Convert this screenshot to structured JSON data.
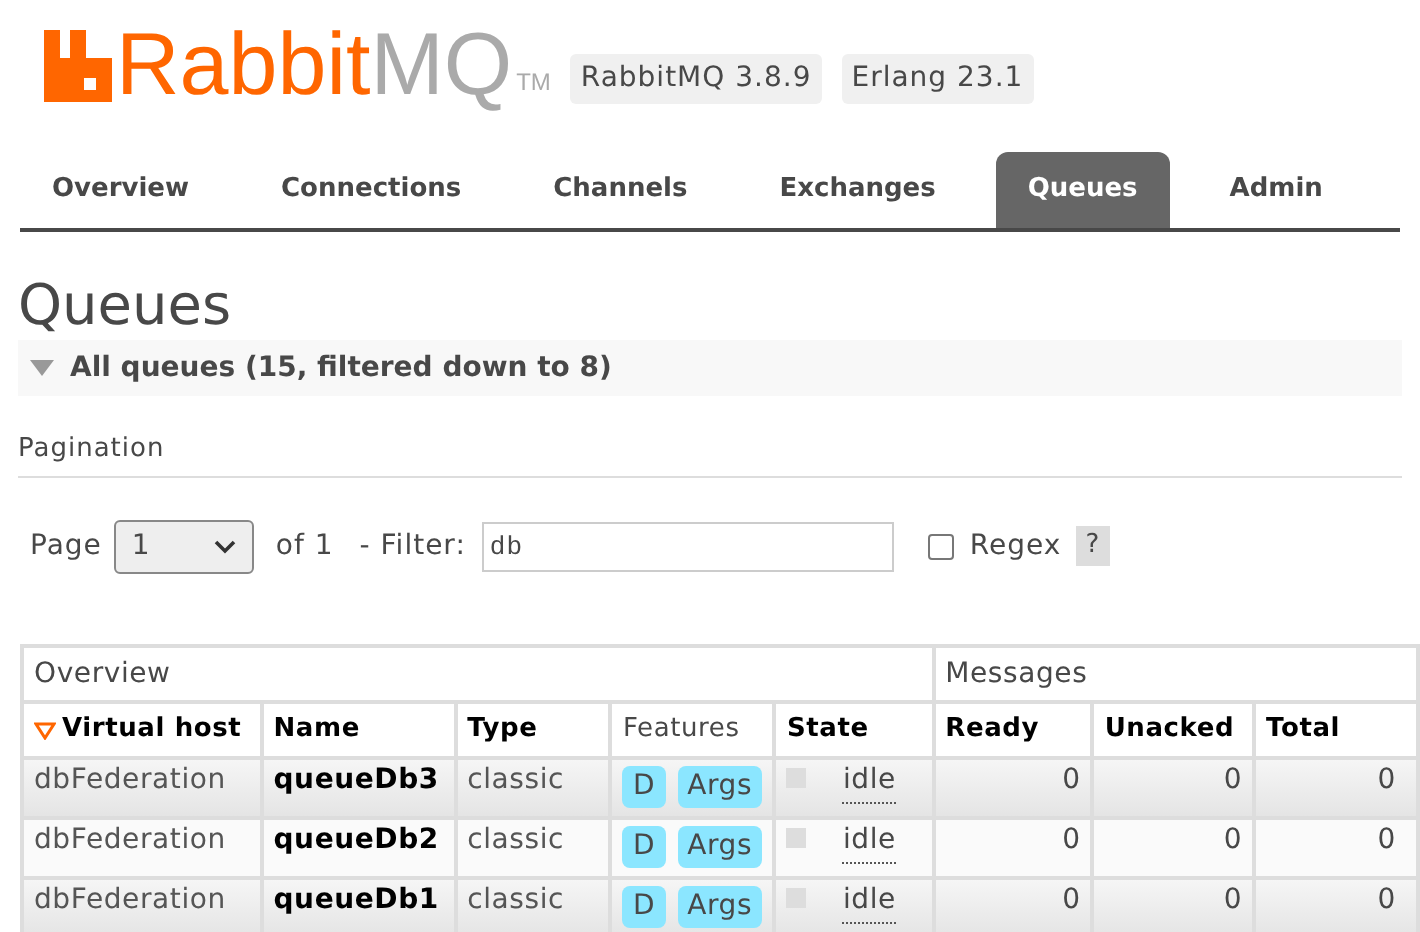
{
  "logo": {
    "brand": "Rabbit",
    "suffix": "MQ",
    "tm": "TM"
  },
  "versions": [
    "RabbitMQ 3.8.9",
    "Erlang 23.1"
  ],
  "tabs": [
    {
      "label": "Overview",
      "selected": false
    },
    {
      "label": "Connections",
      "selected": false
    },
    {
      "label": "Channels",
      "selected": false
    },
    {
      "label": "Exchanges",
      "selected": false
    },
    {
      "label": "Queues",
      "selected": true
    },
    {
      "label": "Admin",
      "selected": false
    }
  ],
  "page_title": "Queues",
  "section": {
    "title": "All queues (15, filtered down to 8)",
    "expanded": true
  },
  "pagination": {
    "heading": "Pagination",
    "page_label": "Page",
    "page_value": "1",
    "of_label": "of 1",
    "filter_label": "- Filter:",
    "filter_value": "db",
    "regex_label": "Regex",
    "regex_checked": false,
    "help": "?"
  },
  "table": {
    "groups": [
      "Overview",
      "Messages"
    ],
    "columns": [
      {
        "label": "Virtual host",
        "sorted": true,
        "bold": true
      },
      {
        "label": "Name",
        "sorted": false,
        "bold": true
      },
      {
        "label": "Type",
        "sorted": false,
        "bold": true
      },
      {
        "label": "Features",
        "sorted": false,
        "bold": false
      },
      {
        "label": "State",
        "sorted": false,
        "bold": true
      },
      {
        "label": "Ready",
        "sorted": false,
        "bold": true
      },
      {
        "label": "Unacked",
        "sorted": false,
        "bold": true
      },
      {
        "label": "Total",
        "sorted": false,
        "bold": true
      }
    ],
    "rows": [
      {
        "vhost": "dbFederation",
        "name": "queueDb3",
        "type": "classic",
        "features": [
          "D",
          "Args"
        ],
        "state": "idle",
        "ready": "0",
        "unacked": "0",
        "total": "0"
      },
      {
        "vhost": "dbFederation",
        "name": "queueDb2",
        "type": "classic",
        "features": [
          "D",
          "Args"
        ],
        "state": "idle",
        "ready": "0",
        "unacked": "0",
        "total": "0"
      },
      {
        "vhost": "dbFederation",
        "name": "queueDb1",
        "type": "classic",
        "features": [
          "D",
          "Args"
        ],
        "state": "idle",
        "ready": "0",
        "unacked": "0",
        "total": "0"
      }
    ]
  }
}
